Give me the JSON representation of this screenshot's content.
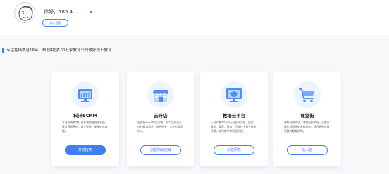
{
  "header": {
    "greeting": "你好，185 4 ",
    "bind_button": "绑定设置"
  },
  "slogan": "专注在线教育16年，帮助中国100万家教育公司做好线上教育",
  "cards": [
    {
      "title": "科汛SCRM",
      "desc": "专注在线教育行业私域流量管理系统，解决获客营销、客户管理、促单转化难题。",
      "button": "开通应用",
      "icon": "monitor-chart-icon",
      "button_style": "primary"
    },
    {
      "title": "云开店",
      "desc": "轻量级SaaS知识店铺，多个工具满足在线教育需求，适合拥有个人IP的知识大V。",
      "button": "创建知识店铺",
      "icon": "storefront-icon",
      "button_style": "outline"
    },
    {
      "title": "教培云平台",
      "desc": "一站式教育培训行业解决方案，招生、教学、管理、服务，打通线上线下教学场景，实现教学和数据同步。",
      "button": "创建网校",
      "icon": "graduation-cap-icon",
      "button_style": "outline"
    },
    {
      "title": "课堂街",
      "desc": "课程分销市场，课程批发市场，汇集全网优质资源的课程超市，适合直播流量双赢的教育机构。",
      "button": "去入驻",
      "icon": "shopping-cart-icon",
      "button_style": "outline"
    }
  ],
  "colors": {
    "accent": "#3f7ef3",
    "notification": "#e8453c",
    "page_bg": "#f7f8fa"
  }
}
